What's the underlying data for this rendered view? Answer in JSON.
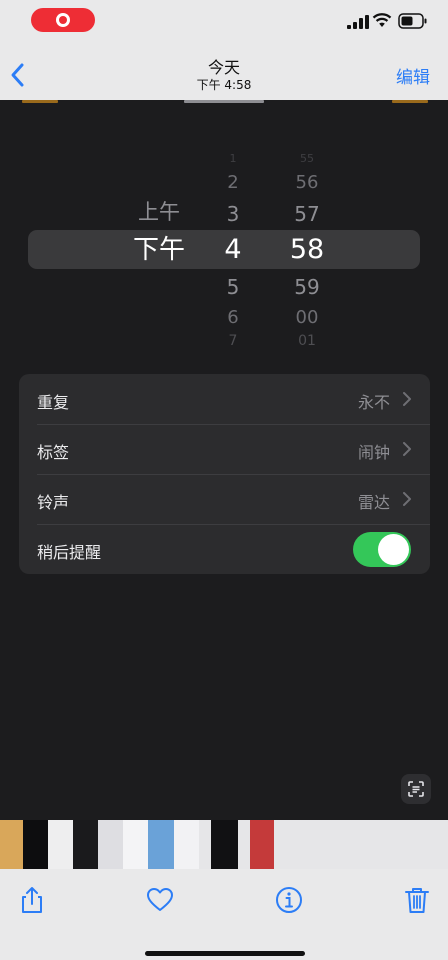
{
  "status_bar": {
    "recording": true,
    "icons": [
      "record-icon",
      "signal-icon",
      "wifi-icon",
      "battery-icon"
    ]
  },
  "nav": {
    "title": "今天",
    "subtitle": "下午 4:58",
    "edit_label": "编辑",
    "back_icon": "chevron-left-icon"
  },
  "picker": {
    "ampm": {
      "above": "上午",
      "selected": "下午"
    },
    "hours": {
      "selected": "4",
      "above": [
        "3",
        "2",
        "1"
      ],
      "below": [
        "5",
        "6",
        "7"
      ]
    },
    "minutes": {
      "selected": "58",
      "above": [
        "57",
        "56",
        "55"
      ],
      "below": [
        "59",
        "00",
        "01"
      ]
    }
  },
  "settings": {
    "repeat": {
      "label": "重复",
      "value": "永不"
    },
    "label": {
      "label": "标签",
      "value": "闹钟"
    },
    "sound": {
      "label": "铃声",
      "value": "雷达"
    },
    "snooze": {
      "label": "稍后提醒",
      "enabled": true
    }
  },
  "toolbar": {
    "icons": [
      "share-icon",
      "heart-icon",
      "info-icon",
      "trash-icon"
    ]
  },
  "colors": {
    "accent": "#2c7df6",
    "toggle_on": "#34c759",
    "record": "#ee2d35",
    "background": "#1c1c1e",
    "cell": "#2c2c2e"
  }
}
